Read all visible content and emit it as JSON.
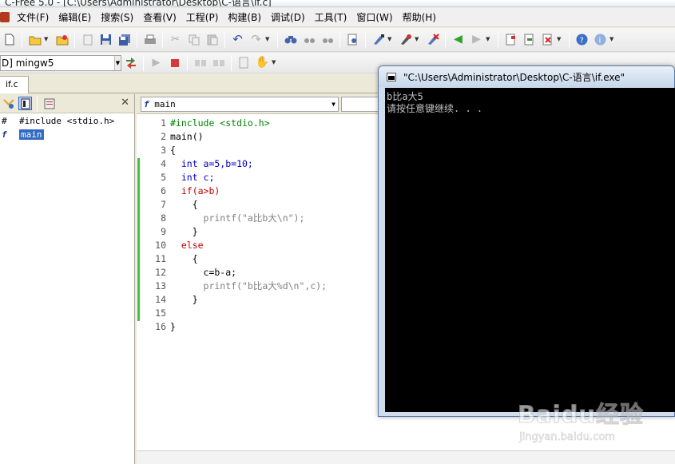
{
  "window": {
    "title": "C-Free 5.0 - [C:\\Users\\Administrator\\Desktop\\C-语言\\if.c]"
  },
  "menu": [
    "文件(F)",
    "编辑(E)",
    "搜索(S)",
    "查看(V)",
    "工程(P)",
    "构建(B)",
    "调试(D)",
    "工具(T)",
    "窗口(W)",
    "帮助(H)"
  ],
  "toolbar2": {
    "compiler_value": "D] mingw5"
  },
  "file_tab": {
    "label": "if.c"
  },
  "class_browser": {
    "items": [
      {
        "icon": "#",
        "label": "#include <stdio.h>"
      },
      {
        "icon": "f",
        "label": "main"
      }
    ]
  },
  "editor": {
    "function_select": "main",
    "lines": [
      {
        "n": "1",
        "text": "#include <stdio.h>"
      },
      {
        "n": "2",
        "text": "main()"
      },
      {
        "n": "3",
        "text": "{"
      },
      {
        "n": "4",
        "text": "  int a=5,b=10;"
      },
      {
        "n": "5",
        "text": "  int c;"
      },
      {
        "n": "6",
        "text": "  if(a>b)"
      },
      {
        "n": "7",
        "text": "    {"
      },
      {
        "n": "8",
        "text": "      printf(\"a比b大\\n\");"
      },
      {
        "n": "9",
        "text": "    }"
      },
      {
        "n": "10",
        "text": "  else"
      },
      {
        "n": "11",
        "text": "    {"
      },
      {
        "n": "12",
        "text": "      c=b-a;"
      },
      {
        "n": "13",
        "text": "      printf(\"b比a大%d\\n\",c);"
      },
      {
        "n": "14",
        "text": "    }"
      },
      {
        "n": "15",
        "text": ""
      },
      {
        "n": "16",
        "text": "}"
      }
    ]
  },
  "console": {
    "title": "\"C:\\Users\\Administrator\\Desktop\\C-语言\\if.exe\"",
    "output": [
      "b比a大5",
      "请按任意键继续. . ."
    ]
  },
  "watermark": {
    "logo": "Baidu经验",
    "sub": "jingyan.baidu.com"
  },
  "colors": {
    "keyword": "#0000c0",
    "control_keyword": "#c00000",
    "preprocessor": "#008000",
    "string": "#808080",
    "change_bar": "#3cc43c",
    "selection": "#316ac5"
  }
}
